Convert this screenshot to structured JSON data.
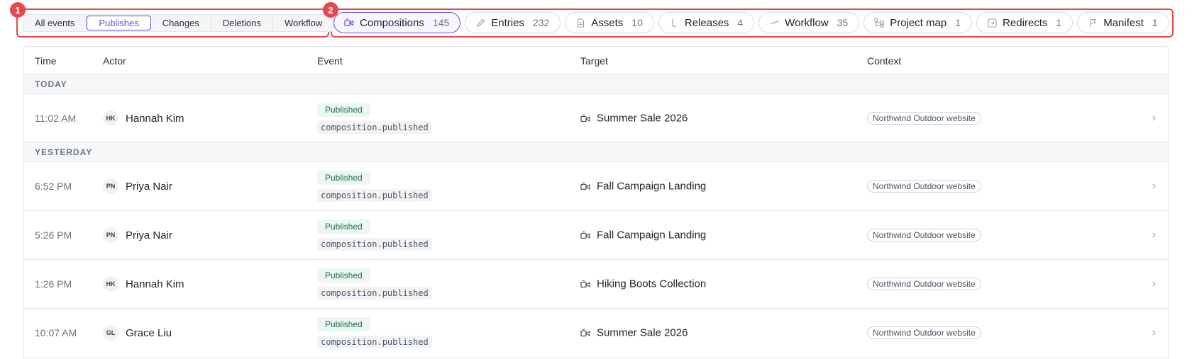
{
  "callouts": {
    "one": "1",
    "two": "2"
  },
  "event_filters": [
    {
      "label": "All events",
      "active": false
    },
    {
      "label": "Publishes",
      "active": true
    },
    {
      "label": "Changes",
      "active": false
    },
    {
      "label": "Deletions",
      "active": false
    },
    {
      "label": "Workflow",
      "active": false
    }
  ],
  "type_chips": [
    {
      "label": "Compositions",
      "count": "145",
      "icon": "composition-icon",
      "active": true
    },
    {
      "label": "Entries",
      "count": "232",
      "icon": "pencil-icon",
      "active": false
    },
    {
      "label": "Assets",
      "count": "10",
      "icon": "document-icon",
      "active": false
    },
    {
      "label": "Releases",
      "count": "4",
      "icon": "release-icon",
      "active": false
    },
    {
      "label": "Workflow",
      "count": "35",
      "icon": "workflow-icon",
      "active": false
    },
    {
      "label": "Project map",
      "count": "1",
      "icon": "sitemap-icon",
      "active": false
    },
    {
      "label": "Redirects",
      "count": "1",
      "icon": "redirect-icon",
      "active": false
    },
    {
      "label": "Manifest",
      "count": "1",
      "icon": "flag-icon",
      "active": false
    }
  ],
  "table": {
    "headers": {
      "time": "Time",
      "actor": "Actor",
      "event": "Event",
      "target": "Target",
      "context": "Context"
    },
    "groups": [
      {
        "label": "TODAY",
        "rows": [
          {
            "time": "11:02 AM",
            "initials": "HK",
            "actor": "Hannah Kim",
            "status": "Published",
            "event_code": "composition.published",
            "target": "Summer Sale 2026",
            "context": "Northwind Outdoor website"
          }
        ]
      },
      {
        "label": "YESTERDAY",
        "rows": [
          {
            "time": "6:52 PM",
            "initials": "PN",
            "actor": "Priya Nair",
            "status": "Published",
            "event_code": "composition.published",
            "target": "Fall Campaign Landing",
            "context": "Northwind Outdoor website"
          },
          {
            "time": "5:26 PM",
            "initials": "PN",
            "actor": "Priya Nair",
            "status": "Published",
            "event_code": "composition.published",
            "target": "Fall Campaign Landing",
            "context": "Northwind Outdoor website"
          },
          {
            "time": "1:26 PM",
            "initials": "HK",
            "actor": "Hannah Kim",
            "status": "Published",
            "event_code": "composition.published",
            "target": "Hiking Boots Collection",
            "context": "Northwind Outdoor website"
          },
          {
            "time": "10:07 AM",
            "initials": "GL",
            "actor": "Grace Liu",
            "status": "Published",
            "event_code": "composition.published",
            "target": "Summer Sale 2026",
            "context": "Northwind Outdoor website"
          }
        ]
      }
    ]
  },
  "colors": {
    "accent": "#6a4fd6",
    "callout": "#e5484d",
    "published_badge": "#ebf7f0"
  }
}
